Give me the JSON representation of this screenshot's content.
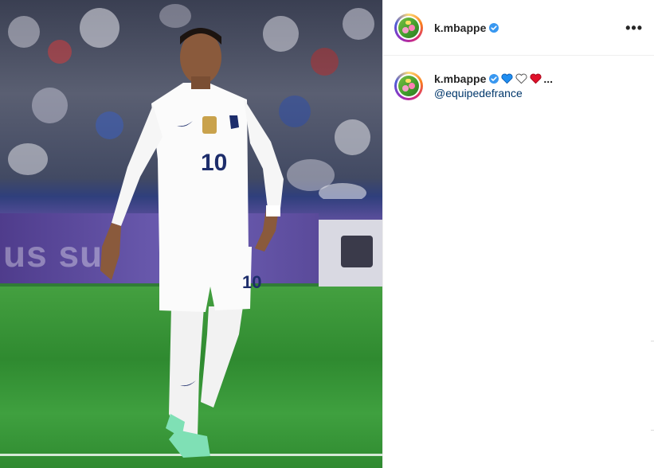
{
  "post": {
    "username": "k.mbappe",
    "verified": true,
    "more_icon": "ellipsis-horizontal-icon",
    "caption": {
      "username": "k.mbappe",
      "emojis": [
        "blue-heart-icon",
        "white-heart-icon",
        "red-heart-icon"
      ],
      "emoji_colors": [
        "#1f8ef1",
        "#ffffff",
        "#e0102a"
      ],
      "ellipsis": "...",
      "mention": "@equipedefrance"
    }
  },
  "photo": {
    "banner_text": "us sur",
    "jersey_number": "10",
    "shorts_number": "10"
  }
}
